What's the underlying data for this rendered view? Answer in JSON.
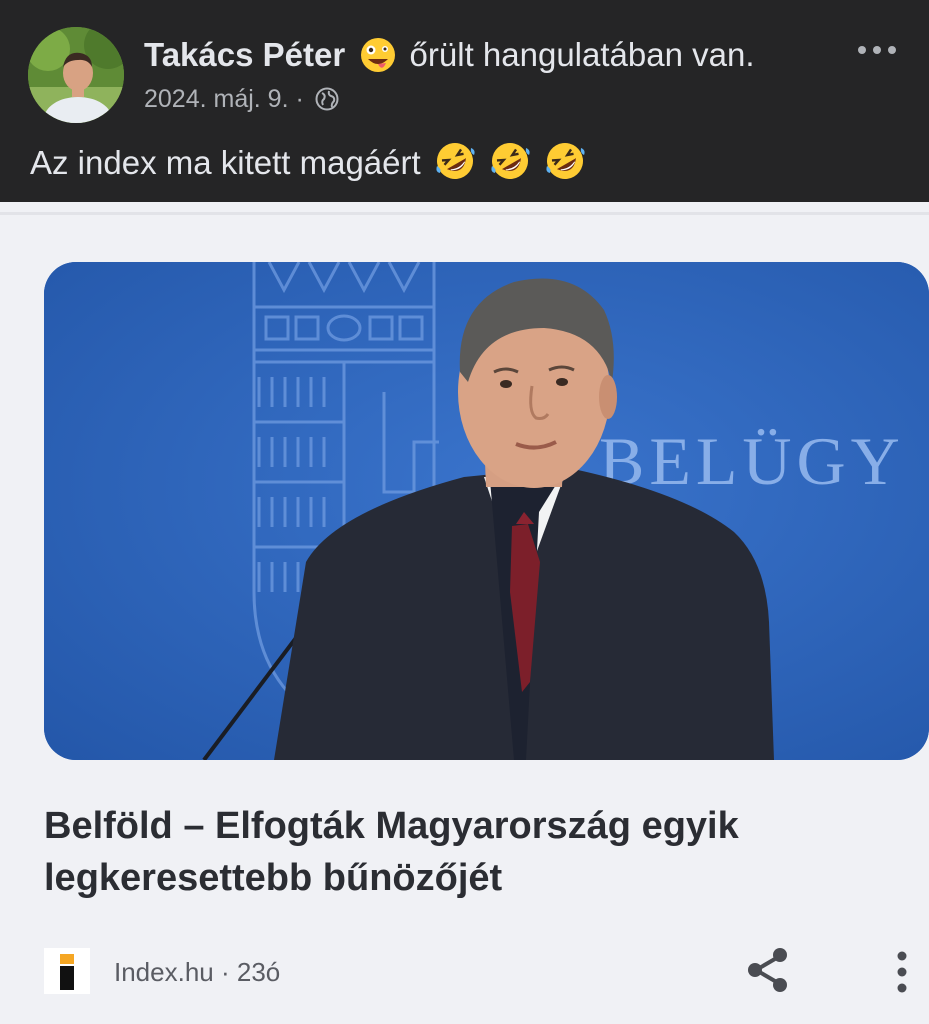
{
  "post": {
    "author": "Takács Péter",
    "feeling_emoji": "zany-face-emoji",
    "feeling_text": "őrült hangulatában van.",
    "date": "2024. máj. 9.",
    "separator": "·",
    "audience_icon": "globe-icon",
    "more_icon": "more-dots-icon",
    "text": "Az index ma kitett magáért",
    "text_emojis": [
      "rolling-laughing-emoji",
      "rolling-laughing-emoji",
      "rolling-laughing-emoji"
    ]
  },
  "shared_card": {
    "thumbnail_sign_text": "BELÜGY",
    "headline": "Belföld – Elfogták Magyarország egyik legkeresettebb bűnözőjét",
    "source": "Index.hu · 23ó",
    "source_logo_icon": "index-logo-icon",
    "share_icon": "share-icon",
    "menu_icon": "vertical-dots-icon"
  },
  "colors": {
    "header_bg": "#252526",
    "card_bg": "#f0f1f5",
    "thumb_blue": "#2a61b8",
    "headline_text": "#2b2d33",
    "meta_text": "#b0b3b8"
  }
}
